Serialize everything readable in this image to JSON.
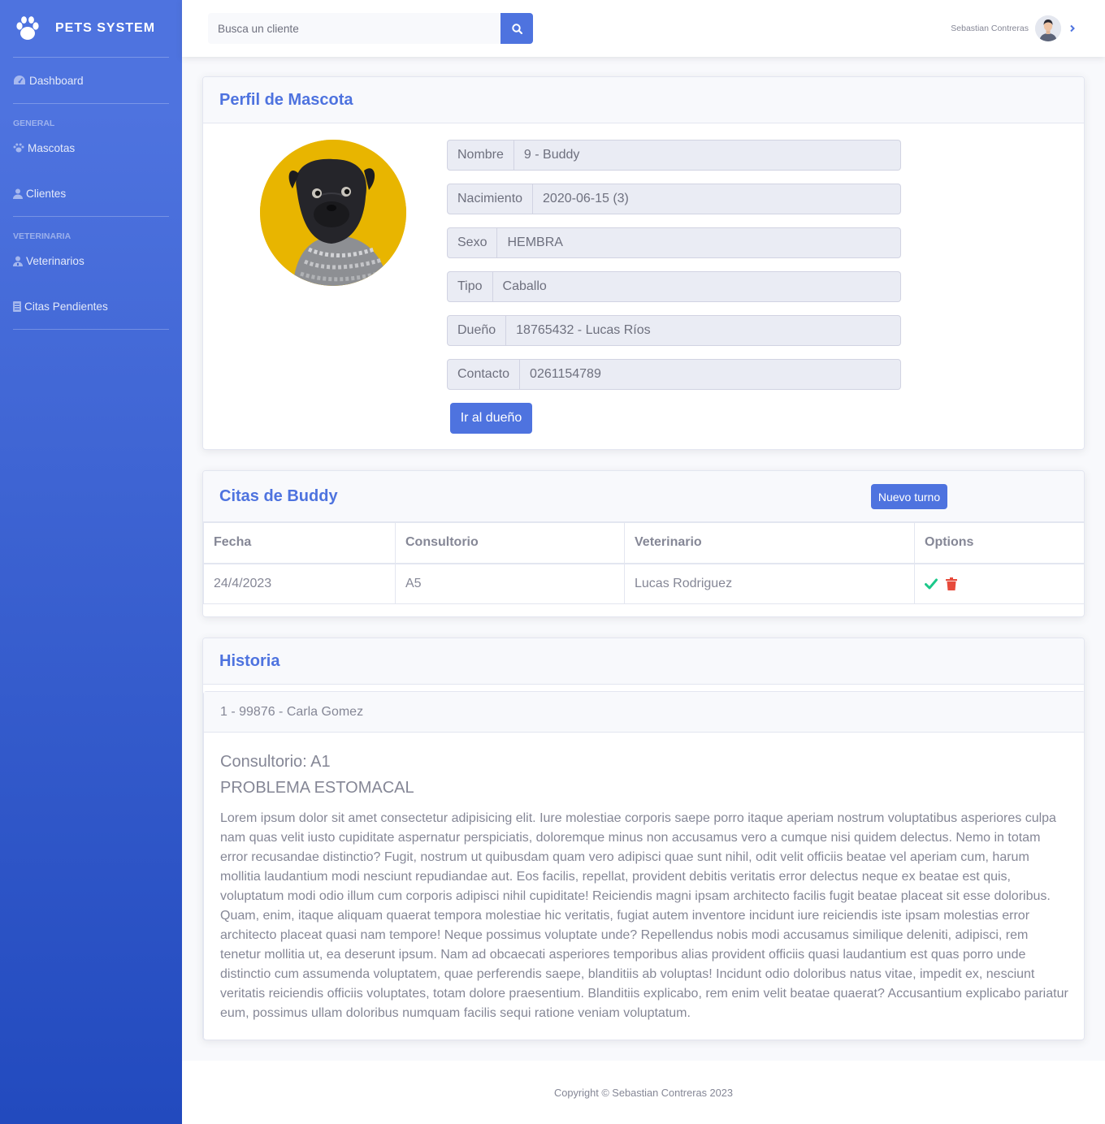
{
  "brand": {
    "name": "PETS SYSTEM",
    "icon": "paw-icon"
  },
  "sidebar": {
    "dashboard": {
      "label": "Dashboard",
      "icon": "tachometer-icon"
    },
    "heading_general": "GENERAL",
    "mascotas": {
      "label": "Mascotas",
      "icon": "paw-icon"
    },
    "clientes": {
      "label": "Clientes",
      "icon": "user-icon"
    },
    "heading_veterinaria": "VETERINARIA",
    "veterinarios": {
      "label": "Veterinarios",
      "icon": "user-doctor-icon"
    },
    "citas": {
      "label": "Citas Pendientes",
      "icon": "list-icon"
    }
  },
  "topbar": {
    "search_placeholder": "Busca un cliente",
    "user_name": "Sebastian Contreras"
  },
  "profile": {
    "title": "Perfil de Mascota",
    "fields": [
      {
        "label": "Nombre",
        "value": "9 - Buddy"
      },
      {
        "label": "Nacimiento",
        "value": "2020-06-15 (3)"
      },
      {
        "label": "Sexo",
        "value": "HEMBRA"
      },
      {
        "label": "Tipo",
        "value": "Caballo"
      },
      {
        "label": "Dueño",
        "value": "18765432 - Lucas Ríos"
      },
      {
        "label": "Contacto",
        "value": "0261154789"
      }
    ],
    "owner_button": "Ir al dueño"
  },
  "appointments": {
    "title": "Citas de Buddy",
    "new_button": "Nuevo turno",
    "columns": [
      "Fecha",
      "Consultorio",
      "Veterinario",
      "Options"
    ],
    "rows": [
      {
        "fecha": "24/4/2023",
        "consultorio": "A5",
        "veterinario": "Lucas Rodriguez"
      }
    ],
    "colors": {
      "check": "#1cc88a",
      "trash": "#e74a3b"
    }
  },
  "history": {
    "title": "Historia",
    "entries": [
      {
        "header": "1 - 99876 - Carla Gomez",
        "consultorio": "Consultorio: A1",
        "problem": "PROBLEMA ESTOMACAL",
        "description": "Lorem ipsum dolor sit amet consectetur adipisicing elit. Iure molestiae corporis saepe porro itaque aperiam nostrum voluptatibus asperiores culpa nam quas velit iusto cupiditate aspernatur perspiciatis, doloremque minus non accusamus vero a cumque nisi quidem delectus. Nemo in totam error recusandae distinctio? Fugit, nostrum ut quibusdam quam vero adipisci quae sunt nihil, odit velit officiis beatae vel aperiam cum, harum mollitia laudantium modi nesciunt repudiandae aut. Eos facilis, repellat, provident debitis veritatis error delectus neque ex beatae est quis, voluptatum modi odio illum cum corporis adipisci nihil cupiditate! Reiciendis magni ipsam architecto facilis fugit beatae placeat sit esse doloribus. Quam, enim, itaque aliquam quaerat tempora molestiae hic veritatis, fugiat autem inventore incidunt iure reiciendis iste ipsam molestias error architecto placeat quasi nam tempore! Neque possimus voluptate unde? Repellendus nobis modi accusamus similique deleniti, adipisci, rem tenetur mollitia ut, ea deserunt ipsum. Nam ad obcaecati asperiores temporibus alias provident officiis quasi laudantium est quas porro unde distinctio cum assumenda voluptatem, quae perferendis saepe, blanditiis ab voluptas! Incidunt odio doloribus natus vitae, impedit ex, nesciunt veritatis reiciendis officiis voluptates, totam dolore praesentium. Blanditiis explicabo, rem enim velit beatae quaerat? Accusantium explicabo pariatur eum, possimus ullam doloribus numquam facilis sequi ratione veniam voluptatum."
      }
    ]
  },
  "footer": {
    "copyright": "Copyright © Sebastian Contreras 2023"
  },
  "theme": {
    "primary": "#4e73df",
    "sidebar_dark": "#224abe",
    "text": "#858796",
    "pet_background": "#e8b500"
  }
}
